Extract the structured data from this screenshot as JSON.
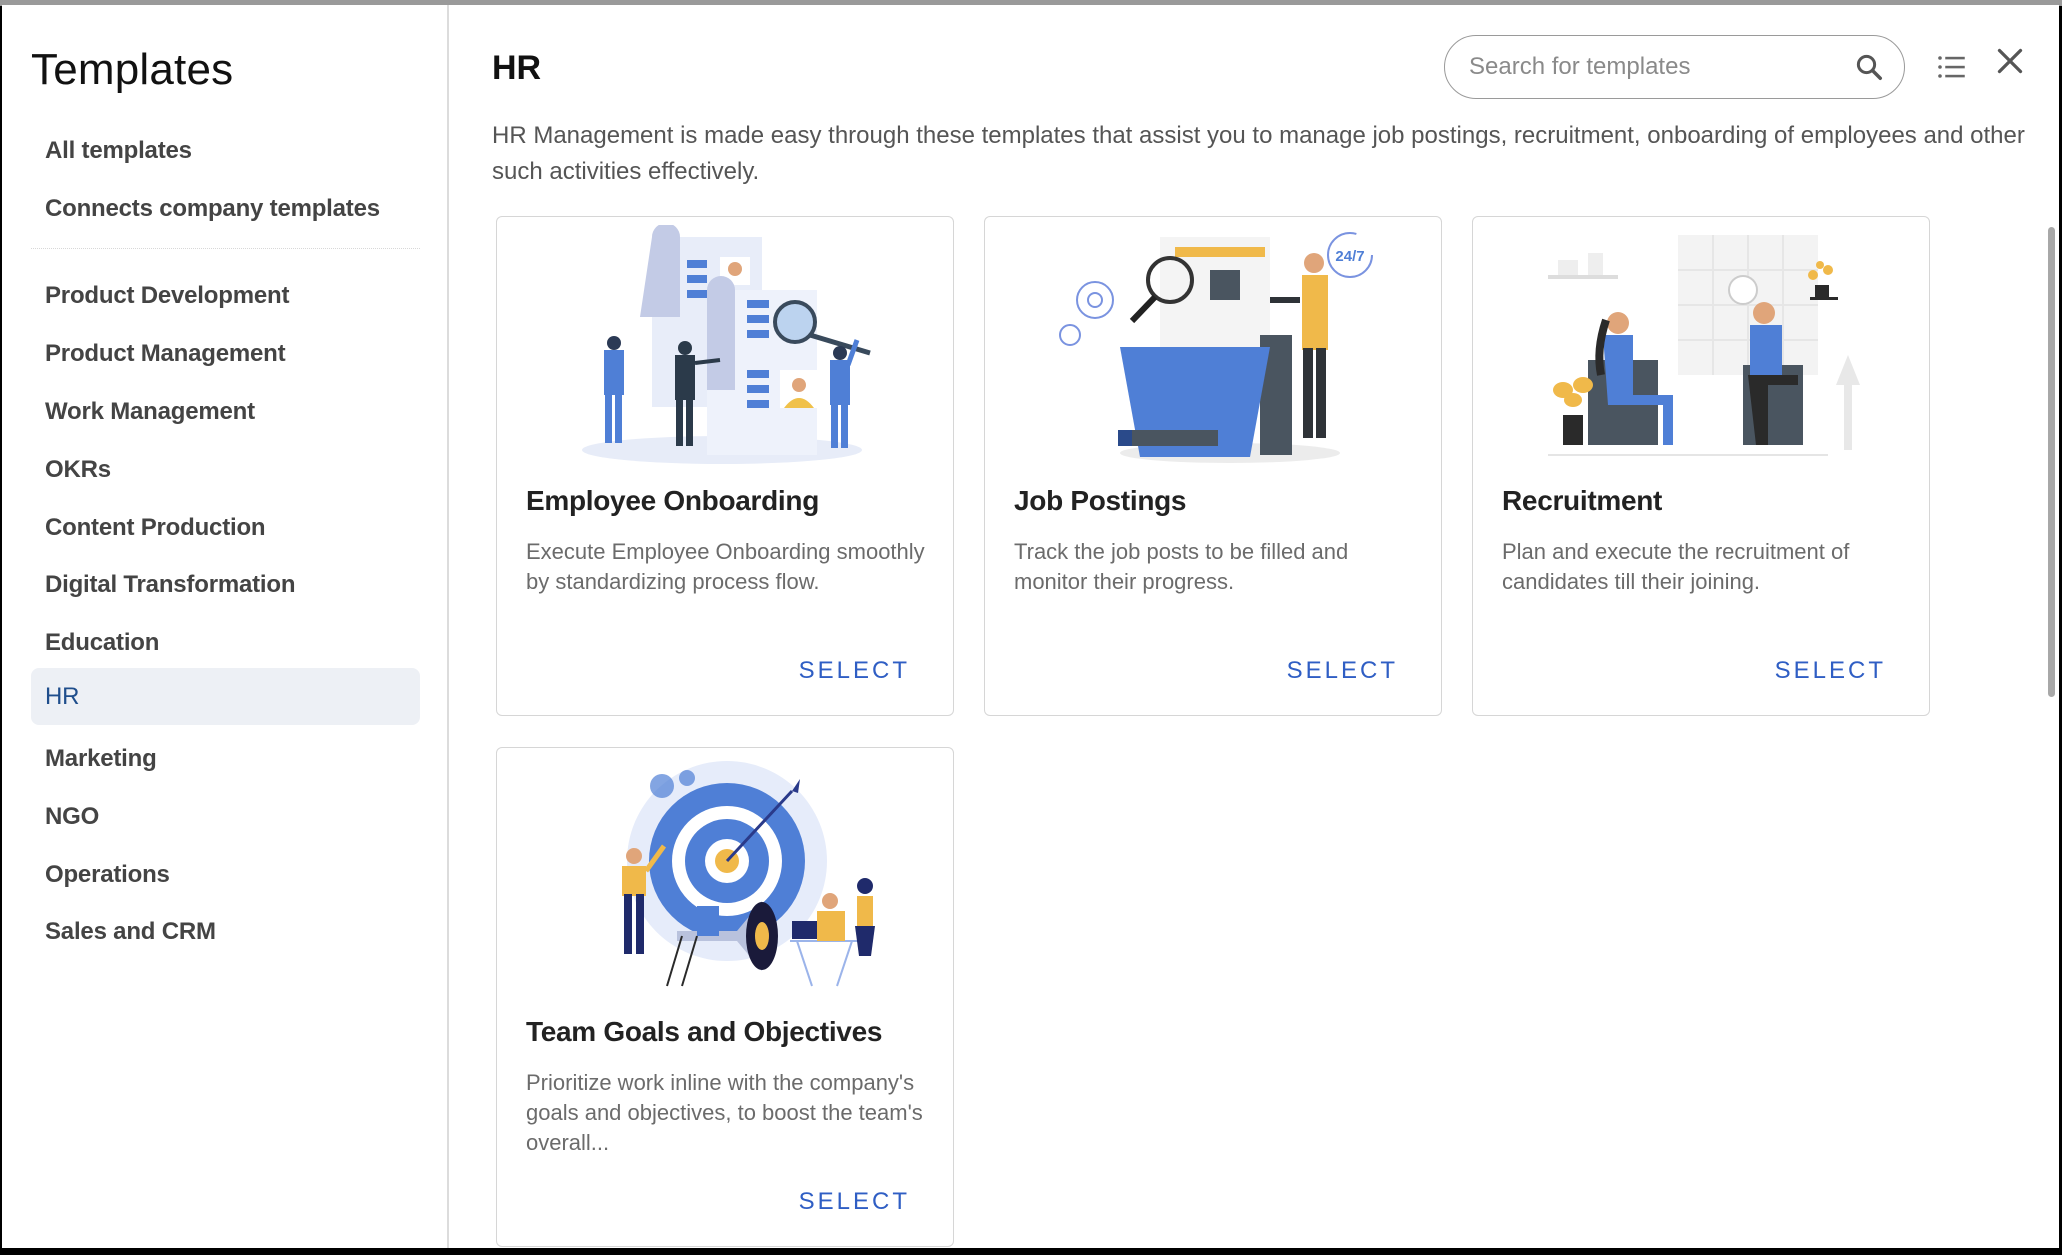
{
  "sidebar": {
    "title": "Templates",
    "top_items": [
      {
        "label": "All templates"
      },
      {
        "label": "Connects company templates"
      }
    ],
    "categories": [
      {
        "label": "Product Development"
      },
      {
        "label": "Product Management"
      },
      {
        "label": "Work Management"
      },
      {
        "label": "OKRs"
      },
      {
        "label": "Content Production"
      },
      {
        "label": "Digital Transformation"
      },
      {
        "label": "Education"
      },
      {
        "label": "HR",
        "active": true
      },
      {
        "label": "Marketing"
      },
      {
        "label": "NGO"
      },
      {
        "label": "Operations"
      },
      {
        "label": "Sales and CRM"
      }
    ]
  },
  "header": {
    "title": "HR",
    "description": "HR Management is made easy through these templates that assist you to manage job postings, recruitment, onboarding of employees and other such activities effectively.",
    "search_placeholder": "Search for templates",
    "search_value": "",
    "icons": {
      "search": "search-icon",
      "view": "list-view-icon",
      "close": "close-icon"
    }
  },
  "cards": [
    {
      "title": "Employee Onboarding",
      "description": "Execute Employee Onboarding smoothly by standardizing process flow.",
      "action": "SELECT",
      "illustration": "onboarding-illustration"
    },
    {
      "title": "Job Postings",
      "description": "Track the job posts to be filled and monitor their progress.",
      "action": "SELECT",
      "illustration": "job-postings-illustration",
      "badge": "24/7"
    },
    {
      "title": "Recruitment",
      "description": "Plan and execute the recruitment of candidates till their joining.",
      "action": "SELECT",
      "illustration": "recruitment-illustration"
    },
    {
      "title": "Team Goals and Objectives",
      "description": "Prioritize work inline with the company's goals and objectives, to boost the team's overall...",
      "action": "SELECT",
      "illustration": "team-goals-illustration"
    }
  ],
  "colors": {
    "accent": "#2f5ec4",
    "active_bg": "#edf0f5",
    "active_text": "#1f4e8c",
    "illustration_blue": "#4f7fd6",
    "illustration_yellow": "#f0b94a"
  }
}
